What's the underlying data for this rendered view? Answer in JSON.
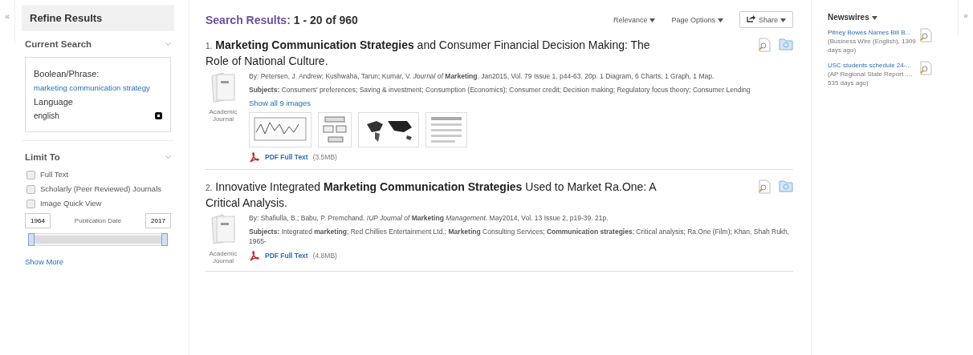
{
  "sidebar": {
    "collapse_icon": "«",
    "title": "Refine Results",
    "current_search": {
      "heading": "Current Search",
      "expanded": true,
      "items": [
        {
          "label": "Boolean/Phrase:",
          "value": "marketing communication strategy",
          "kind": "link"
        },
        {
          "label": "Language",
          "value": "english",
          "kind": "removable"
        }
      ]
    },
    "limit_to": {
      "heading": "Limit To",
      "expanded": true,
      "options": [
        {
          "label": "Full Text",
          "checked": false
        },
        {
          "label": "Scholarly (Peer Reviewed) Journals",
          "checked": false
        },
        {
          "label": "Image Quick View",
          "checked": false
        }
      ],
      "date": {
        "from": "1964",
        "label": "Publication Date",
        "to": "2017",
        "level": 1
      },
      "show_more": "Show More"
    }
  },
  "results": {
    "heading_label": "Search Results:",
    "heading_range": "1 - 20 of 960",
    "toolbar": [
      {
        "label": "Relevance",
        "kind": "menu"
      },
      {
        "label": "Page Options",
        "kind": "menu"
      },
      {
        "label": "Share",
        "kind": "button"
      }
    ],
    "items": [
      {
        "number": "1.",
        "title": "**Marketing Communication Strategies** and Consumer Financial Decision Making: The Role of National Culture.",
        "type": "Academic Journal",
        "source": "By: Petersen, J. Andrew; Kushwaha, Tarun; Kumar, V. *Journal of* **Marketing**. Jan2015, Vol. 79 Issue 1, p44-63. 20p. 1 Diagram, 6 Charts, 1 Graph, 1 Map.",
        "subjects_label": "Subjects:",
        "subjects": "Consumers' preferences; Saving & investment; Consumption (Economics); Consumer credit; Decision making; Regulatory focus theory; Consumer Lending",
        "images_link": "Show all 9 images",
        "images": [
          {
            "kind": "chart"
          },
          {
            "kind": "diagram"
          },
          {
            "kind": "map"
          },
          {
            "kind": "table"
          }
        ],
        "pdf": "PDF Full Text",
        "pdf_size": "(3.5MB)"
      },
      {
        "number": "2.",
        "title": "Innovative Integrated **Marketing Communication Strategies** Used to Market Ra.One: A Critical Analysis.",
        "type": "Academic Journal",
        "source": "By: Shafiulla, B.; Babu, P. Premchand. *IUP Journal of* **Marketing** *Management*. May2014, Vol. 13 Issue 2, p19-39. 21p.",
        "subjects_label": "Subjects:",
        "subjects": "Integrated **marketing**; Red Chillies Entertainment Ltd.; **Marketing** Consulting Services; **Communication strategies**; Critical analysis; Ra.One (Film); Khan, Shah Rukh, 1965-",
        "pdf": "PDF Full Text",
        "pdf_size": "(4.8MB)"
      }
    ]
  },
  "newswires": {
    "title": "Newswires",
    "expand_icon": "»",
    "items": [
      {
        "link": "Pitney Bowes Names Bill B...",
        "meta": "(Business Wire (English), 1309 days ago)"
      },
      {
        "link": "USC students schedule 24-...",
        "meta": "(AP Regional State Report ..., 535 days ago)"
      }
    ]
  }
}
